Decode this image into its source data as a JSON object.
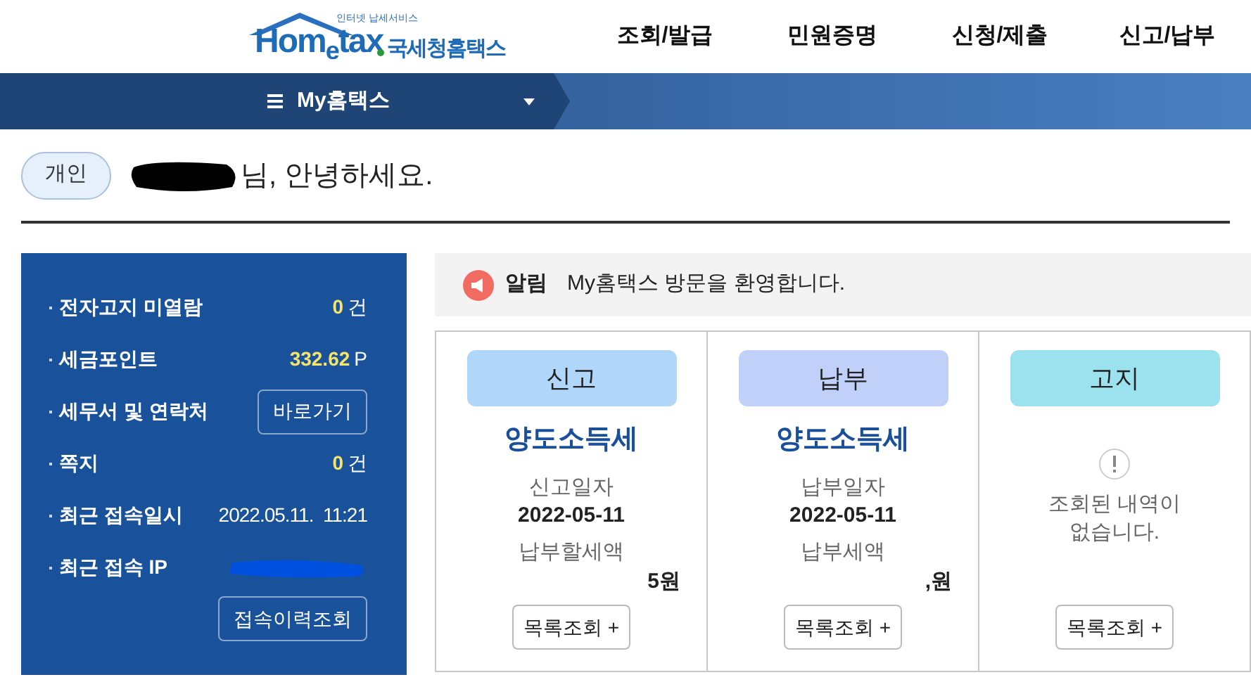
{
  "logo": {
    "tagline": "인터넷 납세서비스",
    "wordmark": "Hom$_{e}$tax",
    "name": "국세청홈택스"
  },
  "nav": [
    {
      "label": "조회/발급"
    },
    {
      "label": "민원증명"
    },
    {
      "label": "신청/제출"
    },
    {
      "label": "신고/납부"
    }
  ],
  "menu_bar": {
    "label": "My홈택스"
  },
  "greeting": {
    "badge": "개인",
    "text": "님, 안녕하세요."
  },
  "sidebar": {
    "items": [
      {
        "kind": "count",
        "label": "전자고지 미열람",
        "value": "0",
        "unit": "건"
      },
      {
        "kind": "count",
        "label": "세금포인트",
        "value": "332.62",
        "unit": "P"
      },
      {
        "kind": "button",
        "label": "세무서 및 연락처",
        "button": "바로가기"
      },
      {
        "kind": "count",
        "label": "쪽지",
        "value": "0",
        "unit": "건"
      },
      {
        "kind": "text",
        "label": "최근 접속일시",
        "value": "2022.05.11.  11:21"
      },
      {
        "kind": "redacted",
        "label": "최근 접속 IP"
      }
    ],
    "history_button": "접속이력조회"
  },
  "notice": {
    "label": "알림",
    "message": "My홈택스 방문을 환영합니다."
  },
  "cards": [
    {
      "kind": "summary",
      "category": "신고",
      "color": "#b0d6fa",
      "title": "양도소득세",
      "date_label": "신고일자",
      "date": "2022-05-11",
      "amount_label": "납부할세액",
      "amount": "5원",
      "button": "목록조회 +"
    },
    {
      "kind": "summary",
      "category": "납부",
      "color": "#c0d0f8",
      "title": "양도소득세",
      "date_label": "납부일자",
      "date": "2022-05-11",
      "amount_label": "납부세액",
      "amount": ",원",
      "button": "목록조회 +"
    },
    {
      "kind": "empty",
      "category": "고지",
      "color": "#9ce2ee",
      "message": "조회된 내역이 없습니다.",
      "button": "목록조회 +"
    }
  ]
}
